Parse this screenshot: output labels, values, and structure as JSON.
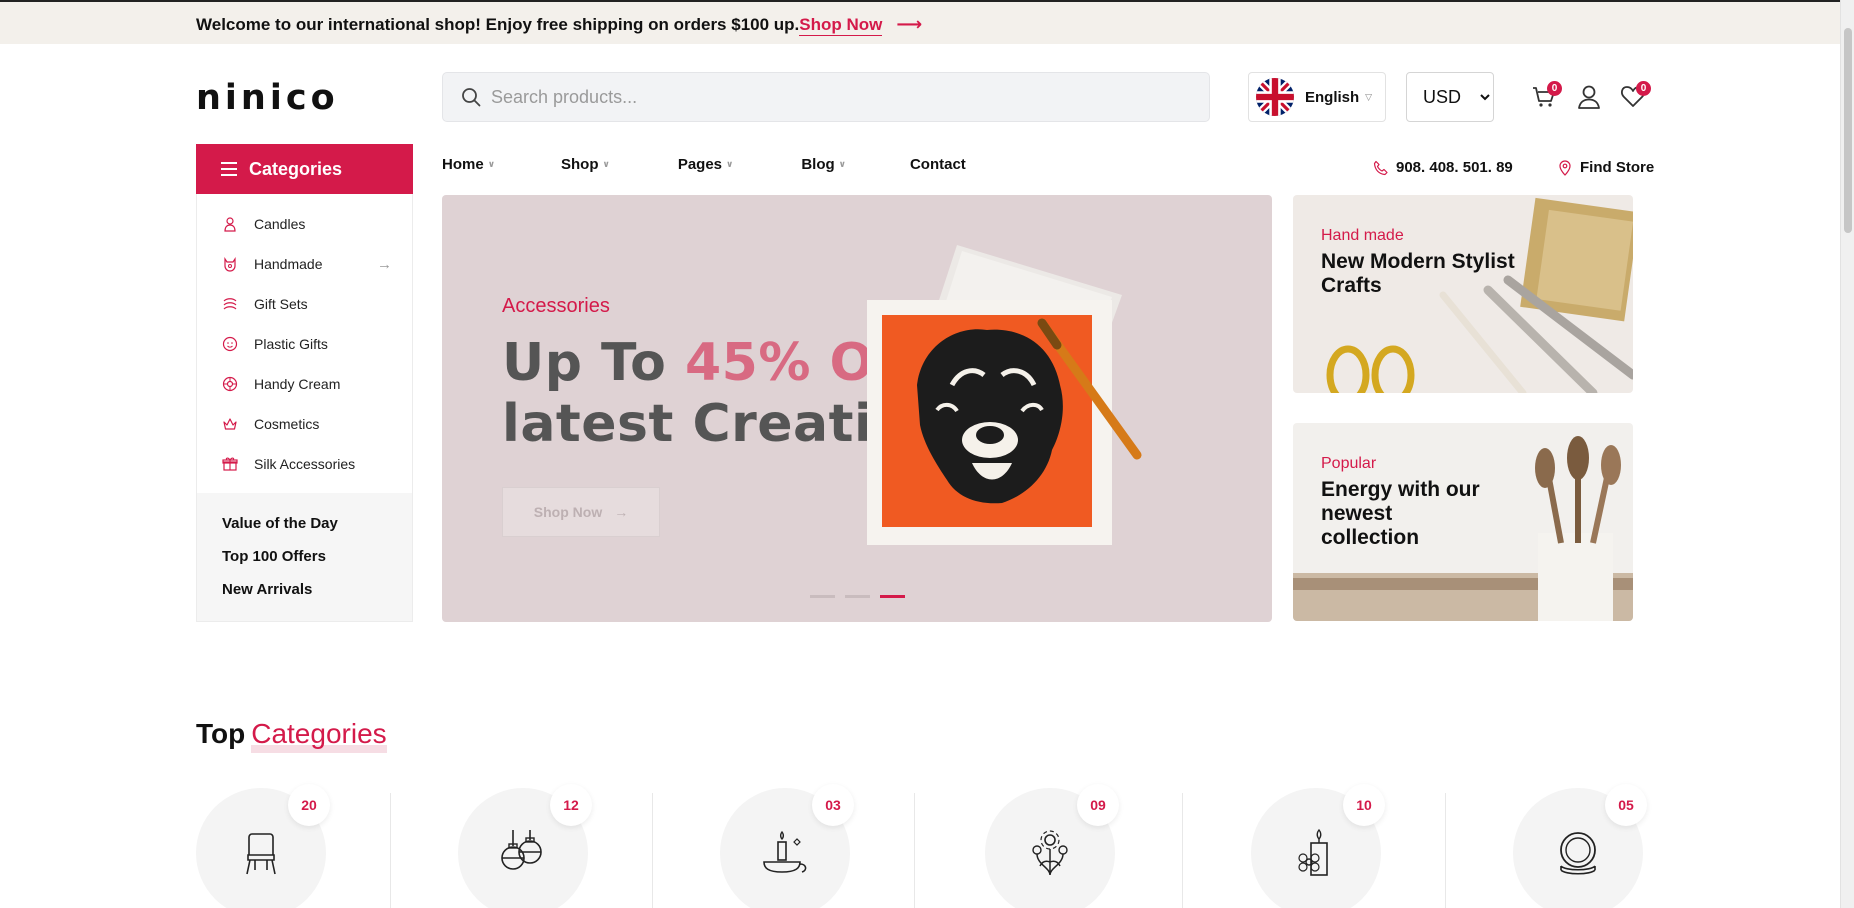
{
  "topbar": {
    "message": "Welcome to our international shop! Enjoy free shipping on orders $100 up.",
    "link_label": "Shop Now"
  },
  "header": {
    "logo": "ninico",
    "search_placeholder": "Search products...",
    "language": "English",
    "currency": "USD",
    "currency_options": [
      "USD"
    ],
    "cart_count": "0",
    "wishlist_count": "0"
  },
  "categories": {
    "title": "Categories",
    "items": [
      {
        "label": "Candles",
        "icon": "candle-icon"
      },
      {
        "label": "Handmade",
        "icon": "handmade-icon"
      },
      {
        "label": "Gift Sets",
        "icon": "gift-sets-icon"
      },
      {
        "label": "Plastic Gifts",
        "icon": "plastic-gifts-icon"
      },
      {
        "label": "Handy Cream",
        "icon": "handy-cream-icon"
      },
      {
        "label": "Cosmetics",
        "icon": "cosmetics-icon"
      },
      {
        "label": "Silk Accessories",
        "icon": "silk-accessories-icon"
      }
    ],
    "extra_links": [
      "Value of the Day",
      "Top 100 Offers",
      "New Arrivals"
    ]
  },
  "nav": {
    "items": [
      "Home",
      "Shop",
      "Pages",
      "Blog",
      "Contact"
    ],
    "phone": "908. 408. 501. 89",
    "find_store": "Find Store"
  },
  "hero": {
    "eyebrow": "Accessories",
    "title_part1": "Up To ",
    "title_highlight": "45% Off",
    "title_line2": "latest Creations",
    "button_label": "Shop Now",
    "slides": 3,
    "active_slide": 3
  },
  "promos": [
    {
      "eyebrow": "Hand made",
      "title": "New Modern Stylist Crafts"
    },
    {
      "eyebrow": "Popular",
      "title": "Energy with our newest collection"
    }
  ],
  "top_categories": {
    "title": "Top",
    "title_accent": "Categories",
    "items": [
      {
        "count": "20",
        "icon": "chair-icon"
      },
      {
        "count": "12",
        "icon": "ornaments-icon"
      },
      {
        "count": "03",
        "icon": "candle-holder-icon"
      },
      {
        "count": "09",
        "icon": "flowers-icon"
      },
      {
        "count": "10",
        "icon": "candle-flower-icon"
      },
      {
        "count": "05",
        "icon": "plates-icon"
      }
    ]
  },
  "colors": {
    "accent": "#d41a4a",
    "topbar_bg": "#f3f0eb",
    "hero_bg": "#dfd2d4"
  }
}
